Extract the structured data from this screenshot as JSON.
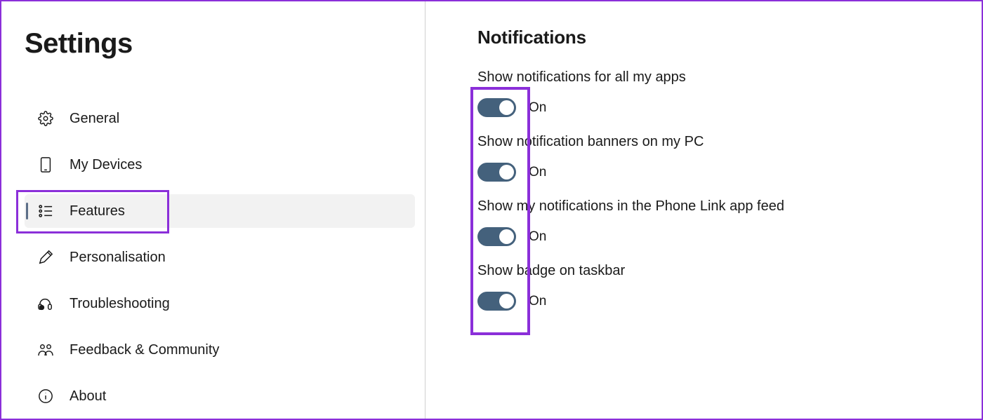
{
  "sidebar": {
    "title": "Settings",
    "items": [
      {
        "label": "General",
        "icon": "gear-icon",
        "active": false
      },
      {
        "label": "My Devices",
        "icon": "device-icon",
        "active": false
      },
      {
        "label": "Features",
        "icon": "features-icon",
        "active": true
      },
      {
        "label": "Personalisation",
        "icon": "pen-icon",
        "active": false
      },
      {
        "label": "Troubleshooting",
        "icon": "troubleshoot-icon",
        "active": false
      },
      {
        "label": "Feedback & Community",
        "icon": "community-icon",
        "active": false
      },
      {
        "label": "About",
        "icon": "info-icon",
        "active": false
      }
    ]
  },
  "content": {
    "heading": "Notifications",
    "settings": [
      {
        "label": "Show notifications for all my apps",
        "state": "On",
        "on": true
      },
      {
        "label": "Show notification banners on my PC",
        "state": "On",
        "on": true
      },
      {
        "label": "Show my notifications in the Phone Link app feed",
        "state": "On",
        "on": true
      },
      {
        "label": "Show badge on taskbar",
        "state": "On",
        "on": true
      }
    ]
  },
  "colors": {
    "accent": "#8b2fd9",
    "toggleOn": "#44617c"
  }
}
